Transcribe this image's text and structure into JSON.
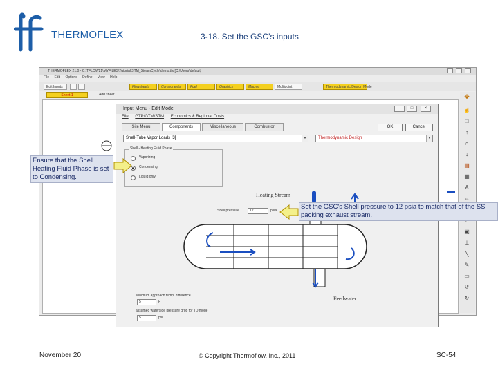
{
  "slide": {
    "logo_text": "THERMOFLEX",
    "title": "3-18. Set the GSC’s inputs",
    "footer_date": "November 20",
    "footer_copyright": "© Copyright Thermoflow, Inc., 2011",
    "footer_slide": "SC-54"
  },
  "colors": {
    "brand": "#1d5ea8",
    "accent_yellow": "#f4d020",
    "callout_fill": "#dde2ee",
    "arrow_blue": "#1a4ec0"
  },
  "app": {
    "title": "THERMOFLEX 21.0 - C:\\TFLOW21\\MYFILES\\Tutorial\\STM_SteamCycle\\demo.tfx [C:\\Users\\default]",
    "menu": [
      "File",
      "Edit",
      "Options",
      "Define",
      "View",
      "Help"
    ],
    "toolbar": {
      "edit_inputs": "Edit Inputs",
      "flowsheets": "Flowsheets",
      "components": "Components",
      "fuel": "Fuel",
      "graphics": "Graphics",
      "macros": "Macros",
      "multipoint": "Multipoint",
      "thermo_mode": "Thermodynamic Design Mode"
    },
    "sheet_tab": "Sheet 1",
    "add_sheet": "Add sheet"
  },
  "dialog": {
    "title": "Input Menu - Edit Mode",
    "menu": [
      "File",
      "GTP/GTM/STM",
      "Economics & Regional Costs"
    ],
    "tabs": [
      "Site Menu",
      "Components",
      "Miscellaneous",
      "Combustor"
    ],
    "ok_label": "OK",
    "cancel_label": "Cancel",
    "component_select": "Shell-Tube Vapor Loads [3]",
    "mode_select": "Thermodynamic Design",
    "group_label": "Shell - Heating Fluid Phase",
    "phase_options": [
      "Vaporizing",
      "Condensing",
      "Liquid only"
    ],
    "selected_phase": "Condensing",
    "heating_stream_label": "Heating Stream",
    "shell_pressure_label": "Shell pressure",
    "shell_pressure_value": "12",
    "shell_pressure_unit": "psia",
    "feedwater_label": "Feedwater",
    "min_approach_label": "Minimum approach temp. difference",
    "min_approach_value": "5",
    "min_approach_unit": "F",
    "pressure_drop_label": "assumed waterside pressure drop for TD mode",
    "pressure_drop_value": "5",
    "pressure_drop_unit": "psi"
  },
  "callouts": {
    "left": "Ensure that the Shell Heating Fluid Phase is set to Condensing.",
    "right": "Set the GSC’s Shell pressure to 12 psia to match that of the SS packing exhaust stream."
  }
}
